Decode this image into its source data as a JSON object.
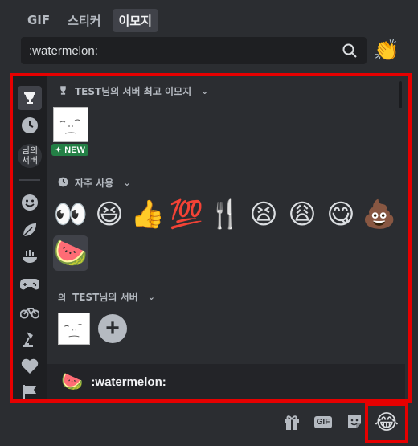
{
  "tabs": [
    {
      "label": "GIF",
      "active": false
    },
    {
      "label": "스티커",
      "active": false
    },
    {
      "label": "이모지",
      "active": true
    }
  ],
  "search": {
    "value": ":watermelon:"
  },
  "skin_tone_emoji": "👏",
  "rail": {
    "server_label": "님의\n서버"
  },
  "sections": {
    "top": {
      "title": "TEST님의 서버 최고 이모지",
      "new_badge": "✦ NEW"
    },
    "frequent": {
      "title": "자주 사용",
      "emojis": [
        "👀",
        "😆",
        "👍",
        "💯",
        "🍴",
        "😫",
        "😩",
        "😋",
        "💩",
        "🍉"
      ]
    },
    "server": {
      "title": "TEST님의 서버"
    }
  },
  "preview": {
    "emoji": "🍉",
    "name": ":watermelon:"
  },
  "bottom": {
    "gif_label": "GIF",
    "emoji_button": "😂"
  }
}
